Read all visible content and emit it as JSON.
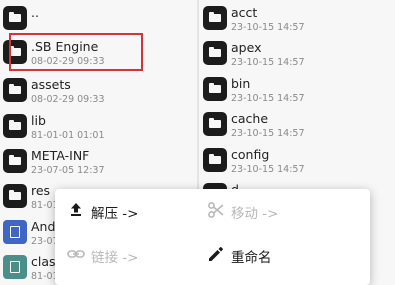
{
  "left_pane": {
    "items": [
      {
        "name": "..",
        "date": "",
        "icon": "folder-icon"
      },
      {
        "name": ".SB Engine",
        "date": "08-02-29 09:33",
        "icon": "folder-icon"
      },
      {
        "name": "assets",
        "date": "08-02-29 09:33",
        "icon": "folder-icon"
      },
      {
        "name": "lib",
        "date": "81-01-01 01:01",
        "icon": "folder-icon"
      },
      {
        "name": "META-INF",
        "date": "23-07-05 12:37",
        "icon": "folder-icon"
      },
      {
        "name": "res",
        "date": "81-01-",
        "icon": "folder-icon"
      },
      {
        "name": "Andr",
        "date": "23-07-",
        "icon": "document-file-icon"
      },
      {
        "name": "class",
        "date": "81-01-",
        "icon": "dex-file-icon"
      }
    ]
  },
  "right_pane": {
    "items": [
      {
        "name": "acct",
        "date": "23-10-15 14:57",
        "icon": "folder-icon"
      },
      {
        "name": "apex",
        "date": "23-10-15 14:57",
        "icon": "folder-icon"
      },
      {
        "name": "bin",
        "date": "23-10-15 14:57",
        "icon": "folder-icon"
      },
      {
        "name": "cache",
        "date": "23-10-15 14:57",
        "icon": "folder-icon"
      },
      {
        "name": "config",
        "date": "23-10-15 14:57",
        "icon": "folder-icon"
      },
      {
        "name": "d",
        "date": "",
        "icon": "folder-icon"
      }
    ]
  },
  "context_menu": {
    "extract_label": "解压 ->",
    "move_label": "移动 ->",
    "link_label": "链接 ->",
    "rename_label": "重命名"
  },
  "colors": {
    "highlight": "#d1343b",
    "folder": "#1c1c1c",
    "disabled_text": "#b8b8b8"
  }
}
